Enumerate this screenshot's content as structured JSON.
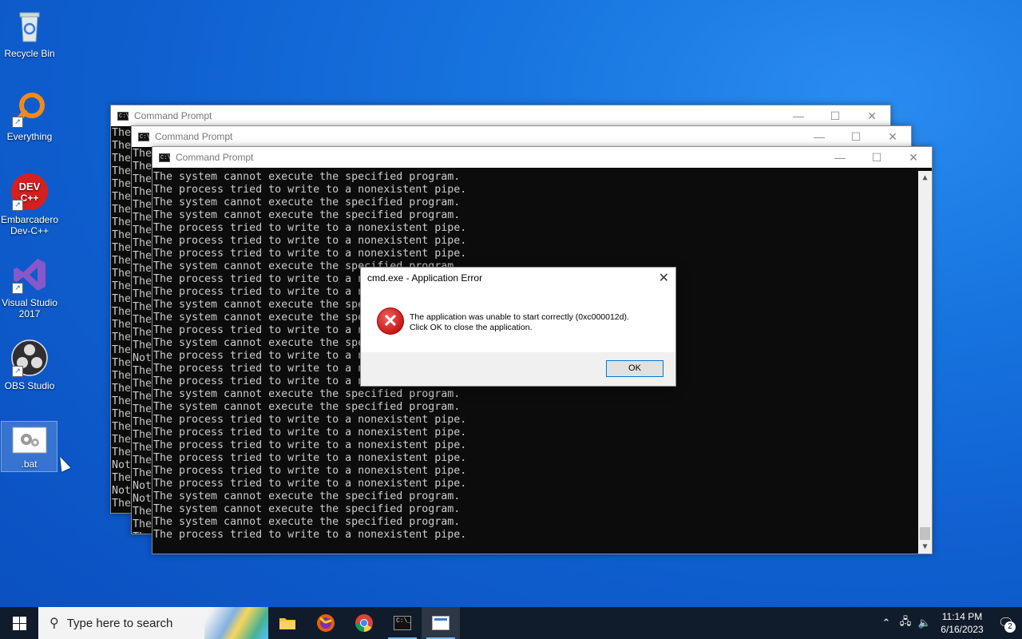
{
  "desktop": {
    "icons": [
      {
        "label": "Recycle Bin"
      },
      {
        "label": "Everything"
      },
      {
        "label": "Embarcadero Dev-C++"
      },
      {
        "label": "Visual Studio 2017"
      },
      {
        "label": "OBS Studio"
      },
      {
        "label": ".bat"
      }
    ]
  },
  "windows": [
    {
      "title": "Command Prompt",
      "prefix": "The"
    },
    {
      "title": "Command Prompt",
      "prefix": "The"
    },
    {
      "title": "Command Prompt"
    }
  ],
  "back_prefixes_1": [
    "The",
    "The",
    "The",
    "The",
    "The",
    "The",
    "The",
    "The",
    "The",
    "The",
    "The",
    "The",
    "The",
    "The",
    "The",
    "The",
    "The",
    "The",
    "The",
    "The",
    "The",
    "The",
    "The",
    "The",
    "The",
    "The",
    "Not",
    "The",
    "Not",
    "The"
  ],
  "back_prefixes_2": [
    "The",
    "The",
    "The",
    "The",
    "The",
    "The",
    "The",
    "The",
    "The",
    "The",
    "The",
    "The",
    "The",
    "The",
    "The",
    "The",
    "Not",
    "The",
    "The",
    "The",
    "The",
    "The",
    "The",
    "The",
    "The",
    "The",
    "Not",
    "Not",
    "The",
    "The",
    "The"
  ],
  "front_lines": [
    "The system cannot execute the specified program.",
    "The process tried to write to a nonexistent pipe.",
    "The system cannot execute the specified program.",
    "The system cannot execute the specified program.",
    "The process tried to write to a nonexistent pipe.",
    "The process tried to write to a nonexistent pipe.",
    "The process tried to write to a nonexistent pipe.",
    "The system cannot execute the specified program.",
    "The process tried to write to a nonexistent pipe.",
    "The process tried to write to a nonexistent pipe.",
    "The system cannot execute the specified program.",
    "The system cannot execute the specified program.",
    "The process tried to write to a nonexistent pipe.",
    "The system cannot execute the specified program.",
    "The process tried to write to a nonexistent pipe.",
    "The process tried to write to a nonexistent pipe.",
    "The process tried to write to a nonexistent pipe.",
    "The system cannot execute the specified program.",
    "The system cannot execute the specified program.",
    "The process tried to write to a nonexistent pipe.",
    "The process tried to write to a nonexistent pipe.",
    "The process tried to write to a nonexistent pipe.",
    "The process tried to write to a nonexistent pipe.",
    "The process tried to write to a nonexistent pipe.",
    "The process tried to write to a nonexistent pipe.",
    "The system cannot execute the specified program.",
    "The system cannot execute the specified program.",
    "The system cannot execute the specified program.",
    "The process tried to write to a nonexistent pipe."
  ],
  "dialog": {
    "title": "cmd.exe - Application Error",
    "line1": "The application was unable to start correctly (0xc000012d).",
    "line2": "Click OK to close the application.",
    "ok_label": "OK"
  },
  "taskbar": {
    "search_placeholder": "Type here to search",
    "time": "11:14 PM",
    "date": "6/16/2023",
    "notifications": "2"
  }
}
